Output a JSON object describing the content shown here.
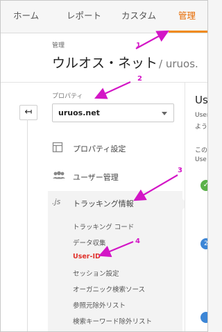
{
  "tabs": [
    "ホーム",
    "レポート",
    "カスタム",
    "管理"
  ],
  "header": {
    "breadcrumb": "管理",
    "title": "ウルオス・ネット",
    "title_sub": "/ uruos."
  },
  "property": {
    "label": "プロパティ",
    "selected": "uruos.net"
  },
  "menu": {
    "settings": {
      "icon": "layout-icon",
      "label": "プロパティ設定"
    },
    "users": {
      "icon": "people-icon",
      "label": "ユーザー管理"
    },
    "tracking": {
      "icon": ".js",
      "label": "トラッキング情報"
    }
  },
  "submenu": [
    {
      "label": "トラッキング コード",
      "active": false
    },
    {
      "label": "データ収集",
      "active": false
    },
    {
      "label": "User-ID",
      "active": true
    },
    {
      "label": "セッション設定",
      "active": false
    },
    {
      "label": "オーガニック検索ソース",
      "active": false
    },
    {
      "label": "参照元除外リスト",
      "active": false
    },
    {
      "label": "検索キーワード除外リスト",
      "active": false
    }
  ],
  "right_panel": {
    "title": "Us",
    "line1": "User",
    "line2": "よう",
    "line3": "この",
    "line4": "Use",
    "step1": "✓",
    "step2": "2"
  },
  "annotations": [
    "1",
    "2",
    "3",
    "4"
  ],
  "colors": {
    "active_tab": "#e66a00",
    "active_sub": "#e0322b",
    "annotation": "#d316c6"
  }
}
